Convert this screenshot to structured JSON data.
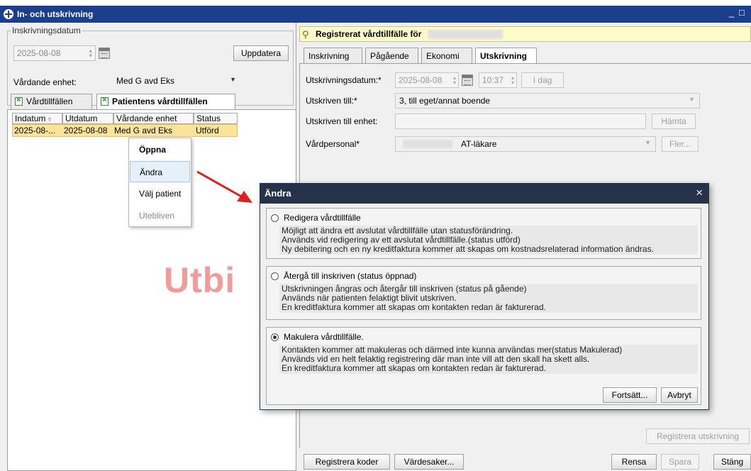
{
  "window": {
    "title": "In- och utskrivning",
    "minimize": "_",
    "maximize": "□"
  },
  "left": {
    "group_label": "Inskrivningsdatum",
    "date": "2025-08-08",
    "update_button": "Uppdatera",
    "unit_label": "Vårdande enhet:",
    "unit_value": "Med G avd Eks",
    "tabs": [
      "Vårdtillfällen",
      "Patientens vårdtillfällen"
    ],
    "columns": [
      "Indatum",
      "Utdatum",
      "Vårdande enhet",
      "Status"
    ],
    "rows": [
      {
        "indatum": "2025-08-...",
        "utdatum": "2025-08-08",
        "enhet": "Med G avd Eks",
        "status": "Utförd"
      }
    ],
    "context_menu": [
      "Öppna",
      "Ändra",
      "Välj patient",
      "Utebliven"
    ],
    "watermark": "Utbi"
  },
  "right": {
    "header_text": "Registrerat vårdtillfälle för",
    "tabs": [
      "Inskrivning",
      "Pågående",
      "Ekonomi",
      "Utskrivning"
    ],
    "discharge_date_label": "Utskrivningsdatum:*",
    "discharge_date": "2025-08-08",
    "discharge_time": "10:37",
    "today_button": "I dag",
    "discharged_to_label": "Utskriven till:*",
    "discharged_to_value": "3, till eget/annat boende",
    "discharged_unit_label": "Utskriven till enhet:",
    "fetch_button": "Hämta",
    "staff_label": "Vårdpersonal*",
    "staff_value": "AT-läkare",
    "more_button": "Fler...",
    "register_discharge_button": "Registrera utskrivning",
    "register_codes_button": "Registrera koder",
    "valuables_button": "Värdesaker...",
    "clear_button": "Rensa",
    "save_button": "Spara",
    "close_button": "Stäng"
  },
  "dialog": {
    "title": "Ändra",
    "close": "×",
    "options": [
      {
        "label": "Redigera vårdtillfälle",
        "selected": false,
        "lines": [
          "Möjligt att ändra ett avslutat vårdtillfälle utan statusförändring.",
          "Används vid redigering av ett avslutat vårdtillfälle.(status utförd)",
          "Ny debitering och en ny kreditfaktura kommer att skapas om kostnadsrelaterad information ändras."
        ]
      },
      {
        "label": "Återgå till inskriven (status öppnad)",
        "selected": false,
        "lines": [
          "Utskrivningen ångras och återgår till inskriven (status på gående)",
          "Används när patienten felaktigt blivit utskriven.",
          "En kreditfaktura kommer att skapas om kontakten redan är fakturerad."
        ]
      },
      {
        "label": "Makulera vårdtillfälle.",
        "selected": true,
        "lines": [
          "Kontakten kommer att makuleras och därmed inte kunna användas mer(status Makulerad)",
          "Används vid en helt felaktig registrering där man inte vill att den skall ha skett alls.",
          "En kreditfaktura kommer att skapas om kontakten redan är fakturerad."
        ]
      }
    ],
    "continue_button": "Fortsätt...",
    "cancel_button": "Avbryt"
  },
  "colors": {
    "titlebar": "#1b3f8c",
    "dialog_titlebar": "#26324a",
    "selected_row": "#fce39a",
    "header_bar": "#fdfcc8",
    "arrow": "#e02020",
    "watermark": "#f39a9a"
  }
}
